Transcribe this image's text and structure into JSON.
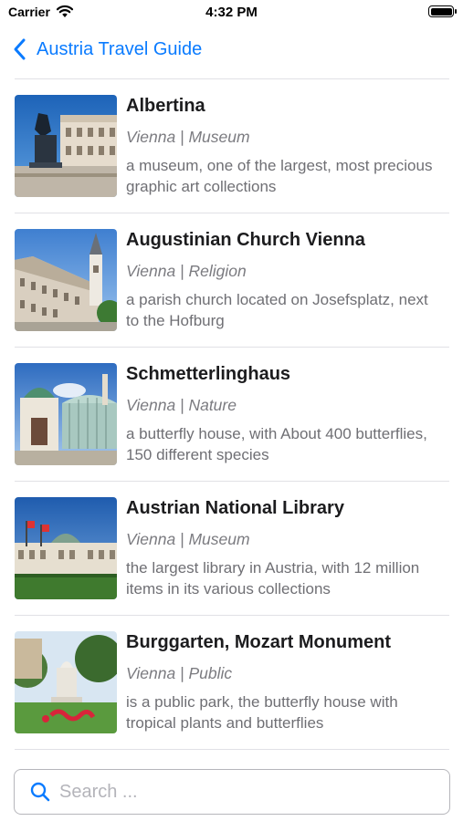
{
  "status_bar": {
    "carrier": "Carrier",
    "time": "4:32 PM"
  },
  "nav": {
    "back_label": "Austria Travel Guide"
  },
  "accent_color": "#0a7bff",
  "places": [
    {
      "title": "Albertina",
      "subtitle": "Vienna | Museum",
      "description": "a museum, one of the largest, most precious graphic art collections"
    },
    {
      "title": "Augustinian Church Vienna",
      "subtitle": "Vienna | Religion",
      "description": "a parish church located on Josefsplatz, next to the Hofburg"
    },
    {
      "title": "Schmetterlinghaus",
      "subtitle": "Vienna | Nature",
      "description": "a butterfly house, with About 400 butterflies, 150 different species"
    },
    {
      "title": "Austrian National Library",
      "subtitle": "Vienna | Museum",
      "description": "the largest library in Austria, with 12 million items in its various collections"
    },
    {
      "title": "Burggarten, Mozart Monument",
      "subtitle": "Vienna | Public",
      "description": "is a public park, the butterfly house with tropical plants and butterflies"
    }
  ],
  "search": {
    "placeholder": "Search ..."
  }
}
